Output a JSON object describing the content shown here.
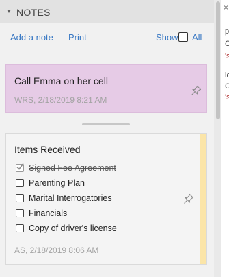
{
  "notes_panel": {
    "title": "NOTES",
    "toolbar": {
      "add_note_label": "Add a note",
      "print_label": "Print",
      "show_label": "Show",
      "all_label": "All",
      "show_all_checked": false
    },
    "notes": [
      {
        "title": "Call Emma on her cell",
        "meta": "WRS, 2/18/2019 8:21 AM",
        "color": "#e6cbe6",
        "pinned_icon": "pin-icon"
      },
      {
        "title": "Items Received",
        "color": "#f4f4f4",
        "stripe_color": "#fbe5a8",
        "checklist": [
          {
            "label": "Signed Fee Agreement",
            "checked": true
          },
          {
            "label": "Parenting Plan",
            "checked": false
          },
          {
            "label": "Marital Interrogatories",
            "checked": false
          },
          {
            "label": "Financials",
            "checked": false
          },
          {
            "label": "Copy of driver's license",
            "checked": false
          }
        ],
        "meta": "AS, 2/18/2019 8:06 AM",
        "pinned_icon": "pin-icon"
      }
    ]
  },
  "right_edge": {
    "top_mark": "×",
    "fragments": [
      {
        "text": "p",
        "color": "#444444"
      },
      {
        "text": "C",
        "color": "#444444"
      },
      {
        "text": "'s",
        "color": "#b03030"
      },
      {
        "text": "lc",
        "color": "#444444"
      },
      {
        "text": "C",
        "color": "#444444"
      },
      {
        "text": "'s",
        "color": "#b03030"
      }
    ]
  },
  "colors": {
    "link": "#3a79c4",
    "meta_text": "#a3a3a3",
    "header_bg": "#e2e2e2"
  }
}
